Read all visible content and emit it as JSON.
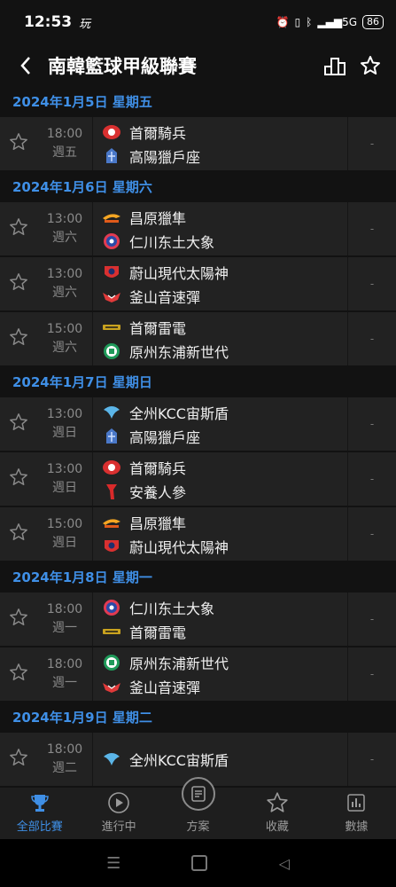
{
  "status": {
    "time": "12:53",
    "app_icon": "玩",
    "signal": "5G",
    "battery": "86"
  },
  "header": {
    "title": "南韓籃球甲級聯賽"
  },
  "schedule": [
    {
      "date": "2024年1月5日 星期五",
      "matches": [
        {
          "time": "18:00",
          "day": "週五",
          "home": "首爾騎兵",
          "away": "高陽獵戶座",
          "home_logo": "red-knight-logo",
          "away_logo": "blue-orion-logo",
          "score": "-"
        }
      ]
    },
    {
      "date": "2024年1月6日 星期六",
      "matches": [
        {
          "time": "13:00",
          "day": "週六",
          "home": "昌原獵隼",
          "away": "仁川东土大象",
          "home_logo": "orange-falcon-logo",
          "away_logo": "blue-elephant-logo",
          "score": "-"
        },
        {
          "time": "13:00",
          "day": "週六",
          "home": "蔚山現代太陽神",
          "away": "釜山音速彈",
          "home_logo": "red-sun-logo",
          "away_logo": "red-wing-logo",
          "score": "-"
        },
        {
          "time": "15:00",
          "day": "週六",
          "home": "首爾雷電",
          "away": "原州东浦新世代",
          "home_logo": "yellow-thunder-logo",
          "away_logo": "green-circle-logo",
          "score": "-"
        }
      ]
    },
    {
      "date": "2024年1月7日 星期日",
      "matches": [
        {
          "time": "13:00",
          "day": "週日",
          "home": "全州KCC宙斯盾",
          "away": "高陽獵戶座",
          "home_logo": "blue-aegis-logo",
          "away_logo": "blue-orion-logo",
          "score": "-"
        },
        {
          "time": "13:00",
          "day": "週日",
          "home": "首爾騎兵",
          "away": "安養人參",
          "home_logo": "red-knight-logo",
          "away_logo": "red-ginseng-logo",
          "score": "-"
        },
        {
          "time": "15:00",
          "day": "週日",
          "home": "昌原獵隼",
          "away": "蔚山現代太陽神",
          "home_logo": "orange-falcon-logo",
          "away_logo": "red-sun-logo",
          "score": "-"
        }
      ]
    },
    {
      "date": "2024年1月8日 星期一",
      "matches": [
        {
          "time": "18:00",
          "day": "週一",
          "home": "仁川东土大象",
          "away": "首爾雷電",
          "home_logo": "blue-elephant-logo",
          "away_logo": "yellow-thunder-logo",
          "score": "-"
        },
        {
          "time": "18:00",
          "day": "週一",
          "home": "原州东浦新世代",
          "away": "釜山音速彈",
          "home_logo": "green-circle-logo",
          "away_logo": "red-wing-logo",
          "score": "-"
        }
      ]
    },
    {
      "date": "2024年1月9日 星期二",
      "matches": [
        {
          "time": "18:00",
          "day": "週二",
          "home": "全州KCC宙斯盾",
          "away": "",
          "home_logo": "blue-aegis-logo",
          "away_logo": "",
          "score": "-"
        }
      ]
    }
  ],
  "tabs": [
    {
      "label": "全部比賽",
      "icon": "trophy-icon",
      "active": true
    },
    {
      "label": "進行中",
      "icon": "play-circle-icon",
      "active": false
    },
    {
      "label": "方案",
      "icon": "plan-icon",
      "active": false
    },
    {
      "label": "收藏",
      "icon": "star-icon",
      "active": false
    },
    {
      "label": "數據",
      "icon": "chart-icon",
      "active": false
    }
  ],
  "colors": {
    "accent": "#3f8fe6",
    "background": "#121212",
    "row": "#222222"
  }
}
